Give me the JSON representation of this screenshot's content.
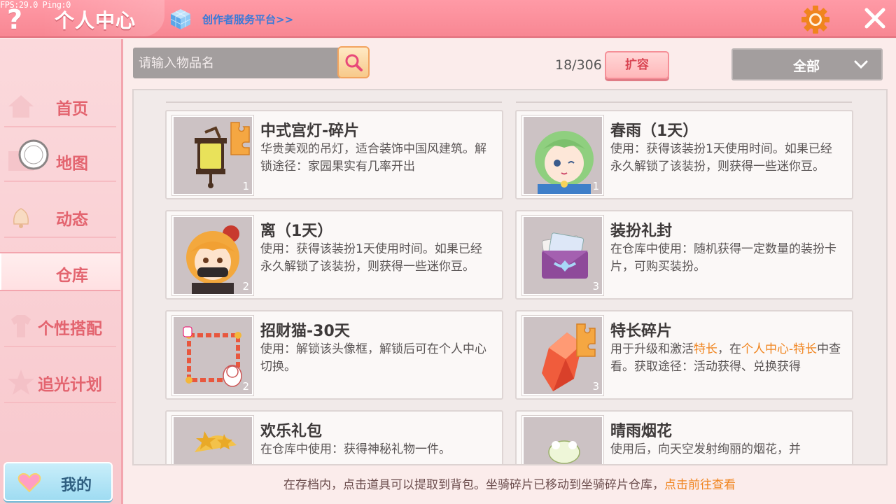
{
  "debug": {
    "fps_text": "FPS:29.0  Ping:0"
  },
  "header": {
    "help_glyph": "?",
    "title": "个人中心",
    "creator_link": "创作者服务平台>>"
  },
  "sidebar": {
    "items": [
      {
        "label": "首页"
      },
      {
        "label": "地图"
      },
      {
        "label": "动态"
      },
      {
        "label": "仓库"
      },
      {
        "label": "个性搭配"
      },
      {
        "label": "追光计划"
      }
    ],
    "active_index": 3,
    "my_label": "我的"
  },
  "toolbar": {
    "search_placeholder": "请输入物品名",
    "count": "18/306",
    "expand_label": "扩容",
    "filter_selected": "全部"
  },
  "items": [
    {
      "name": "中式宫灯-碎片",
      "qty": "1",
      "desc": "华贵美观的吊灯，适合装饰中国风建筑。解锁途径：家园果实有几率开出",
      "icon": "lantern-fragment-icon"
    },
    {
      "name": "春雨（1天）",
      "qty": "1",
      "desc": "使用：获得该装扮1天使用时间。如果已经永久解锁了该装扮，则获得一些迷你豆。",
      "icon": "green-hair-character-icon"
    },
    {
      "name": "离（1天）",
      "qty": "2",
      "desc": "使用：获得该装扮1天使用时间。如果已经永久解锁了该装扮，则获得一些迷你豆。",
      "icon": "masked-character-icon"
    },
    {
      "name": "装扮礼封",
      "qty": "3",
      "desc": "在仓库中使用：随机获得一定数量的装扮卡片，可购买装扮。",
      "icon": "envelope-icon"
    },
    {
      "name": "招财猫-30天",
      "qty": "2",
      "desc": "使用：解锁该头像框，解锁后可在个人中心切换。",
      "icon": "lucky-cat-frame-icon"
    },
    {
      "name": "特长碎片",
      "qty": "3",
      "desc_parts": [
        "用于升级和激活",
        "特长",
        "，在",
        "个人中心-特长",
        "中查看。获取途径：活动获得、兑换获得"
      ],
      "icon": "red-crystal-fragment-icon"
    },
    {
      "name": "欢乐礼包",
      "qty": "",
      "desc": "在仓库中使用：获得神秘礼物一件。",
      "icon": "gift-pack-icon"
    },
    {
      "name": "晴雨烟花",
      "qty": "",
      "desc": "使用后，向天空发射绚丽的烟花，并",
      "icon": "firework-icon"
    }
  ],
  "footer": {
    "tip": "在存档内，点击道具可以提取到背包。坐骑碎片已移动到坐骑碎片仓库，",
    "link": "点击前往查看"
  },
  "colors": {
    "accent": "#f88793",
    "highlight": "#f0841e",
    "link_blue": "#3a7ad8"
  }
}
